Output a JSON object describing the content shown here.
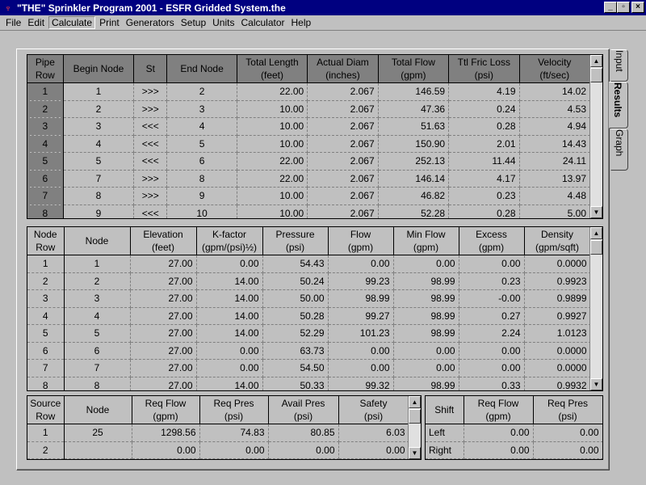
{
  "window": {
    "title": "\"THE\" Sprinkler Program 2001 - ESFR Gridded System.the",
    "btn_min": "_",
    "btn_max": "▫",
    "btn_close": "×"
  },
  "menu": [
    "File",
    "Edit",
    "Calculate",
    "Print",
    "Generators",
    "Setup",
    "Units",
    "Calculator",
    "Help"
  ],
  "tabs": [
    "Input",
    "Results",
    "Graph"
  ],
  "pipe": {
    "headers": [
      "Pipe\nRow",
      "Begin Node",
      "St",
      "End Node",
      "Total Length\n(feet)",
      "Actual Diam\n(inches)",
      "Total Flow\n(gpm)",
      "Ttl Fric Loss\n(psi)",
      "Velocity\n(ft/sec)"
    ],
    "rows": [
      [
        "1",
        "1",
        ">>>",
        "2",
        "22.00",
        "2.067",
        "146.59",
        "4.19",
        "14.02"
      ],
      [
        "2",
        "2",
        ">>>",
        "3",
        "10.00",
        "2.067",
        "47.36",
        "0.24",
        "4.53"
      ],
      [
        "3",
        "3",
        "<<<",
        "4",
        "10.00",
        "2.067",
        "51.63",
        "0.28",
        "4.94"
      ],
      [
        "4",
        "4",
        "<<<",
        "5",
        "10.00",
        "2.067",
        "150.90",
        "2.01",
        "14.43"
      ],
      [
        "5",
        "5",
        "<<<",
        "6",
        "22.00",
        "2.067",
        "252.13",
        "11.44",
        "24.11"
      ],
      [
        "6",
        "7",
        ">>>",
        "8",
        "22.00",
        "2.067",
        "146.14",
        "4.17",
        "13.97"
      ],
      [
        "7",
        "8",
        ">>>",
        "9",
        "10.00",
        "2.067",
        "46.82",
        "0.23",
        "4.48"
      ],
      [
        "8",
        "9",
        "<<<",
        "10",
        "10.00",
        "2.067",
        "52.28",
        "0.28",
        "5.00"
      ]
    ]
  },
  "node": {
    "headers": [
      "Node\nRow",
      "Node",
      "Elevation\n(feet)",
      "K-factor\n(gpm/(psi)½)",
      "Pressure\n(psi)",
      "Flow\n(gpm)",
      "Min Flow\n(gpm)",
      "Excess\n(gpm)",
      "Density\n(gpm/sqft)"
    ],
    "rows": [
      [
        "1",
        "1",
        "27.00",
        "0.00",
        "54.43",
        "0.00",
        "0.00",
        "0.00",
        "0.0000"
      ],
      [
        "2",
        "2",
        "27.00",
        "14.00",
        "50.24",
        "99.23",
        "98.99",
        "0.23",
        "0.9923"
      ],
      [
        "3",
        "3",
        "27.00",
        "14.00",
        "50.00",
        "98.99",
        "98.99",
        "-0.00",
        "0.9899"
      ],
      [
        "4",
        "4",
        "27.00",
        "14.00",
        "50.28",
        "99.27",
        "98.99",
        "0.27",
        "0.9927"
      ],
      [
        "5",
        "5",
        "27.00",
        "14.00",
        "52.29",
        "101.23",
        "98.99",
        "2.24",
        "1.0123"
      ],
      [
        "6",
        "6",
        "27.00",
        "0.00",
        "63.73",
        "0.00",
        "0.00",
        "0.00",
        "0.0000"
      ],
      [
        "7",
        "7",
        "27.00",
        "0.00",
        "54.50",
        "0.00",
        "0.00",
        "0.00",
        "0.0000"
      ],
      [
        "8",
        "8",
        "27.00",
        "14.00",
        "50.33",
        "99.32",
        "98.99",
        "0.33",
        "0.9932"
      ]
    ]
  },
  "source": {
    "headers": [
      "Source\nRow",
      "Node",
      "Req Flow\n(gpm)",
      "Req Pres\n(psi)",
      "Avail Pres\n(psi)",
      "Safety\n(psi)"
    ],
    "rows": [
      [
        "1",
        "25",
        "1298.56",
        "74.83",
        "80.85",
        "6.03"
      ],
      [
        "2",
        "",
        "0.00",
        "0.00",
        "0.00",
        "0.00"
      ]
    ]
  },
  "shift": {
    "headers": [
      "Shift",
      "Req Flow\n(gpm)",
      "Req Pres\n(psi)"
    ],
    "rows": [
      [
        "Left",
        "0.00",
        "0.00"
      ],
      [
        "Right",
        "0.00",
        "0.00"
      ]
    ]
  },
  "scroll": {
    "up": "▲",
    "down": "▼"
  }
}
